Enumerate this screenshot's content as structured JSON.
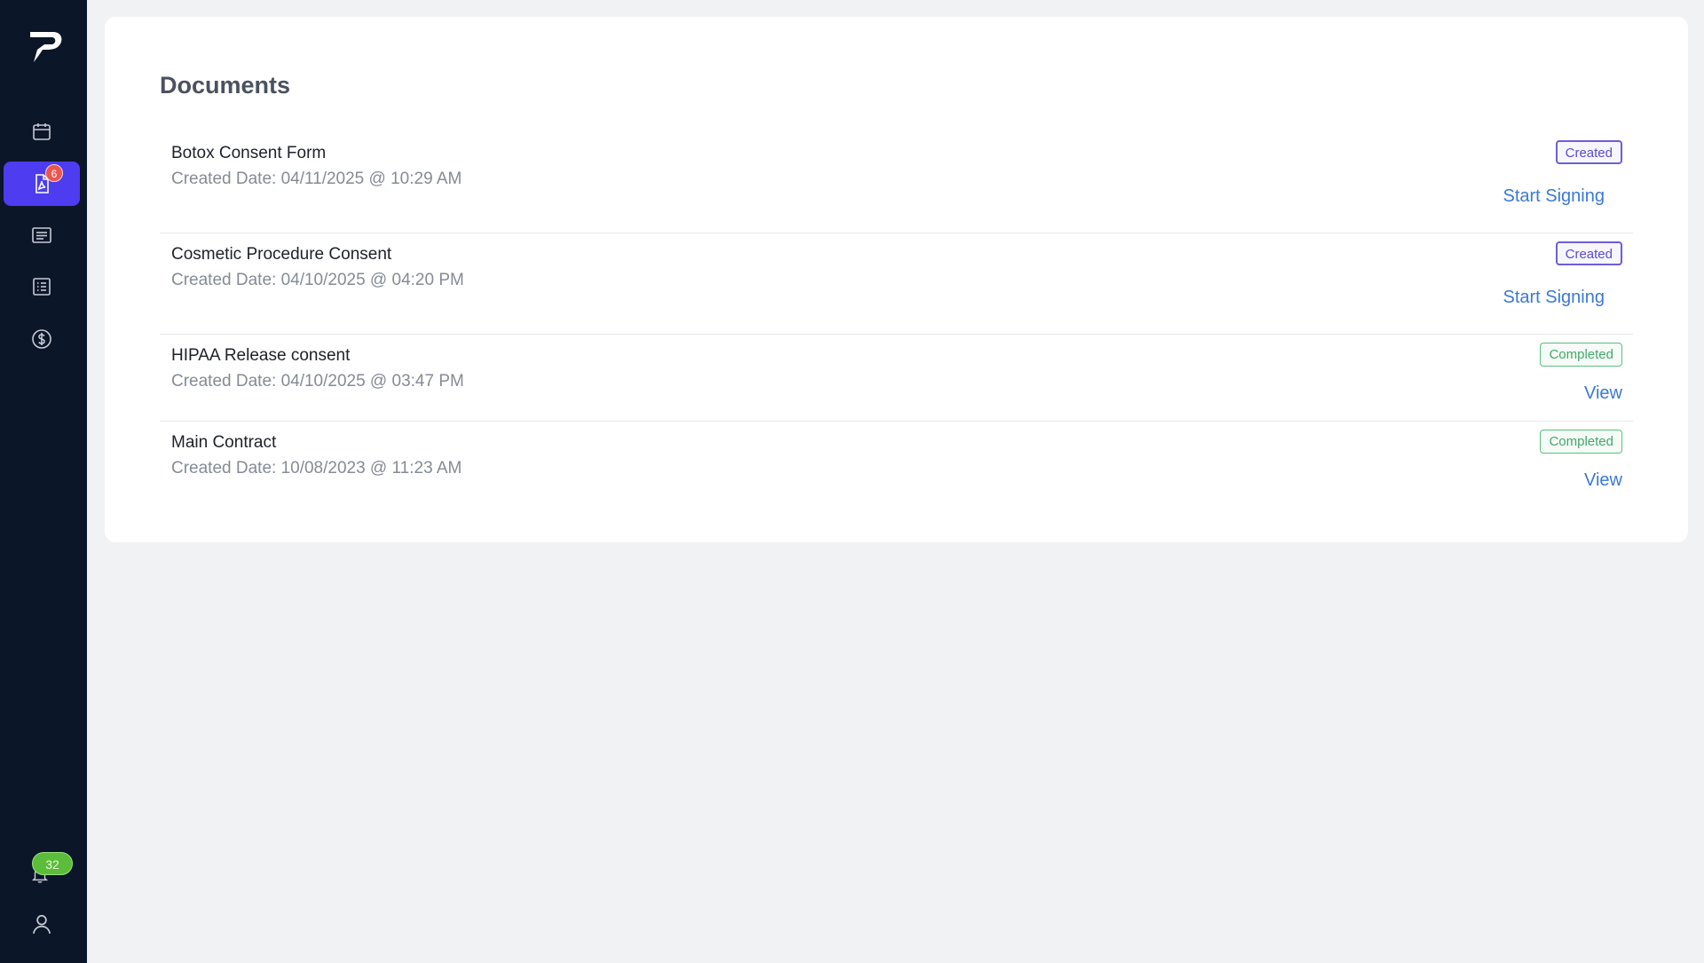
{
  "sidebar": {
    "documents_badge": "6",
    "notifications_badge": "32",
    "items": [
      {
        "name": "calendar"
      },
      {
        "name": "documents",
        "active": true
      },
      {
        "name": "messages"
      },
      {
        "name": "forms"
      },
      {
        "name": "billing"
      }
    ]
  },
  "main": {
    "title": "Documents",
    "documents": [
      {
        "name": "Botox Consent Form",
        "date": "Created Date: 04/11/2025 @ 10:29 AM",
        "status": "Created",
        "action": "Start Signing"
      },
      {
        "name": "Cosmetic Procedure Consent",
        "date": "Created Date: 04/10/2025 @ 04:20 PM",
        "status": "Created",
        "action": "Start Signing"
      },
      {
        "name": "HIPAA Release consent",
        "date": "Created Date: 04/10/2025 @ 03:47 PM",
        "status": "Completed",
        "action": "View"
      },
      {
        "name": "Main Contract",
        "date": "Created Date: 10/08/2023 @ 11:23 AM",
        "status": "Completed",
        "action": "View"
      }
    ]
  },
  "colors": {
    "sidebar_bg": "#0b1629",
    "active_nav": "#4d3cf0",
    "link": "#3a78d6",
    "created_badge": "#6c5ed8",
    "completed_badge": "#5bbf7f",
    "notification_badge": "#5bbd3a",
    "document_badge": "#e8564f"
  }
}
